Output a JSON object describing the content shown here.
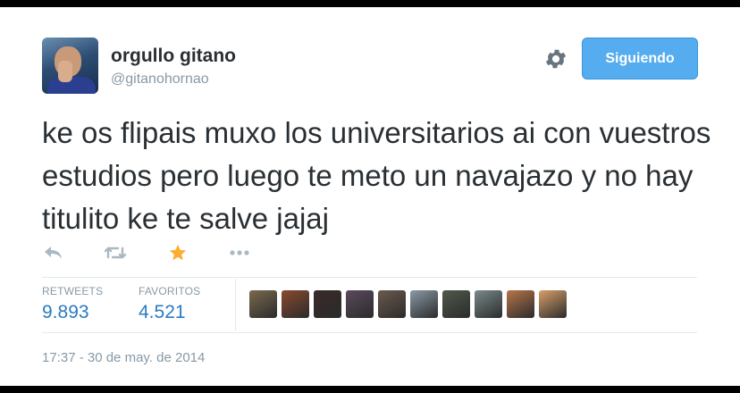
{
  "user": {
    "display_name": "orgullo gitano",
    "handle": "@gitanohornao"
  },
  "header": {
    "follow_button_label": "Siguiendo",
    "settings_icon": "gear-icon"
  },
  "tweet": {
    "text": "ke os flipais muxo los universitarios ai con vuestros estudios pero luego te meto un navajazo y no hay titulito ke te salve jajaj",
    "timestamp": "17:37 - 30 de may. de 2014"
  },
  "actions": [
    {
      "icon": "reply-icon"
    },
    {
      "icon": "retweet-icon"
    },
    {
      "icon": "favorite-star-icon",
      "active": true
    },
    {
      "icon": "more-dots-icon"
    }
  ],
  "stats": {
    "retweets_label": "RETWEETS",
    "retweets_value": "9.893",
    "favorites_label": "FAVORITOS",
    "favorites_value": "4.521"
  },
  "favoriters": [
    {
      "color": "#7a6a4f"
    },
    {
      "color": "#8b4a2f"
    },
    {
      "color": "#3a2a2a"
    },
    {
      "color": "#5a4a5e"
    },
    {
      "color": "#6b5a4e"
    },
    {
      "color": "#8a9aa8"
    },
    {
      "color": "#4f5a4a"
    },
    {
      "color": "#7a8a8a"
    },
    {
      "color": "#b9754a"
    },
    {
      "color": "#d9a06a"
    }
  ],
  "colors": {
    "accent_blue": "#55acee",
    "link_blue": "#2a7bc1",
    "favorite_orange": "#ffac33",
    "muted_gray": "#8899a6"
  }
}
